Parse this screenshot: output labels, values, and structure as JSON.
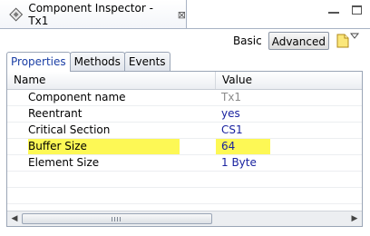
{
  "view": {
    "title": "Component Inspector - Tx1",
    "close_glyph": "⊠"
  },
  "modes": {
    "basic_label": "Basic",
    "advanced_label": "Advanced"
  },
  "tabs": [
    {
      "label": "Properties",
      "active": true
    },
    {
      "label": "Methods",
      "active": false
    },
    {
      "label": "Events",
      "active": false
    }
  ],
  "table": {
    "headers": {
      "name": "Name",
      "value": "Value"
    },
    "rows": [
      {
        "name": "Component name",
        "value": "Tx1"
      },
      {
        "name": "Reentrant",
        "value": "yes"
      },
      {
        "name": "Critical Section",
        "value": "CS1"
      },
      {
        "name": "Buffer Size",
        "value": "64"
      },
      {
        "name": "Element Size",
        "value": "1 Byte"
      }
    ]
  },
  "colors": {
    "highlight": "#fdf855",
    "value_link": "#1a23a0",
    "active_tab_text": "#1a3ea5"
  }
}
